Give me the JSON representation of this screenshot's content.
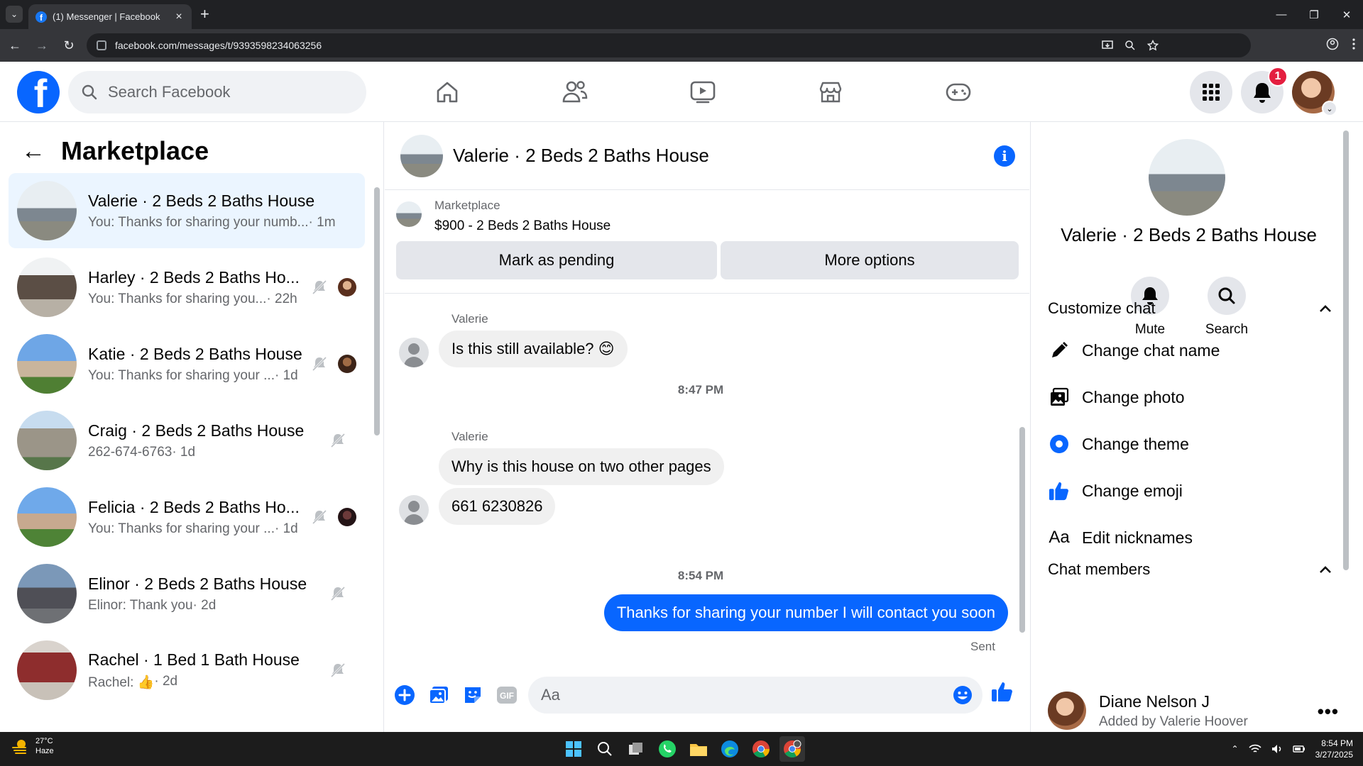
{
  "browser": {
    "tab_title": "(1) Messenger | Facebook",
    "url": "facebook.com/messages/t/9393598234063256"
  },
  "fb_nav": {
    "search_placeholder": "Search Facebook",
    "notification_count": "1"
  },
  "left_panel": {
    "title": "Marketplace",
    "conversations": [
      {
        "name": "Valerie · 2 Beds 2 Baths House",
        "preview": "You: Thanks for sharing your numb...",
        "time": "· 1m",
        "muted": false,
        "active": true
      },
      {
        "name": "Harley · 2 Beds 2 Baths Ho...",
        "preview": "You: Thanks for sharing you...",
        "time": "· 22h",
        "muted": true,
        "active": false
      },
      {
        "name": "Katie · 2 Beds 2 Baths House",
        "preview": "You: Thanks for sharing your ...",
        "time": "· 1d",
        "muted": true,
        "active": false
      },
      {
        "name": "Craig · 2 Beds 2 Baths House",
        "preview": "262-674-6763",
        "time": " · 1d",
        "muted": true,
        "active": false
      },
      {
        "name": "Felicia · 2 Beds 2 Baths Ho...",
        "preview": "You: Thanks for sharing your ...",
        "time": "· 1d",
        "muted": true,
        "active": false
      },
      {
        "name": "Elinor · 2 Beds 2 Baths House",
        "preview": "Elinor: Thank you",
        "time": " · 2d",
        "muted": true,
        "active": false
      },
      {
        "name": "Rachel · 1 Bed 1 Bath House",
        "preview": "Rachel: 👍",
        "time": " · 2d",
        "muted": true,
        "active": false
      }
    ]
  },
  "chat": {
    "title": "Valerie · 2 Beds 2 Baths House",
    "listing_source": "Marketplace",
    "listing_title": "$900 - 2 Beds 2 Baths House",
    "mark_pending_label": "Mark as pending",
    "more_options_label": "More options",
    "messages": [
      {
        "sender": "Valerie",
        "text": "Is this still available? 😊"
      },
      {
        "timestamp": "8:47 PM"
      },
      {
        "sender": "Valerie",
        "text": "Why is this house on two other pages"
      },
      {
        "text": "661 6230826"
      },
      {
        "timestamp": "8:54 PM"
      },
      {
        "text": "Thanks for sharing your number I will contact you soon",
        "outgoing": true
      }
    ],
    "status": "Sent",
    "composer_placeholder": "Aa"
  },
  "right_panel": {
    "title": "Valerie · 2 Beds 2 Baths House",
    "mute_label": "Mute",
    "search_label": "Search",
    "customize_header": "Customize chat",
    "customize_items": [
      "Change chat name",
      "Change photo",
      "Change theme",
      "Change emoji",
      "Edit nicknames"
    ],
    "members_header": "Chat members",
    "member_name": "Diane Nelson J",
    "member_sub": "Added by Valerie Hoover"
  },
  "taskbar": {
    "temp": "27°C",
    "weather": "Haze",
    "time": "8:54 PM",
    "date": "3/27/2025"
  },
  "colors": {
    "accent": "#0866ff",
    "active_bg": "#ebf5ff",
    "badge": "#e41e3f"
  }
}
